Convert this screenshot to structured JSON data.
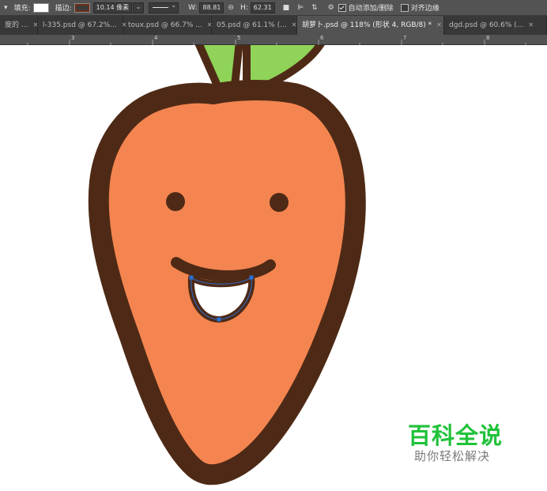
{
  "options_bar": {
    "fill_label": "填充:",
    "fill_color": "#ffffff",
    "stroke_label": "描边:",
    "stroke_color": "#6b2e14",
    "stroke_width": "10.14 像素",
    "w_label": "W:",
    "w_value": "88.81",
    "h_label": "H:",
    "h_value": "62.31",
    "auto_add_delete_label": "自动添加/删除",
    "auto_add_delete_checked": true,
    "align_edges_label": "对齐边缘",
    "align_edges_checked": false
  },
  "tabs": [
    {
      "label": "度的 ...",
      "active": false
    },
    {
      "label": "l-335.psd @ 67.2%...",
      "active": false
    },
    {
      "label": "toux.psd @ 66.7% ...",
      "active": false
    },
    {
      "label": "05.psd @ 61.1% (...",
      "active": false
    },
    {
      "label": "胡萝卜.psd @ 118% (形状 4, RGB/8) *",
      "active": true
    },
    {
      "label": "dgd.psd @ 60.6% (...",
      "active": false
    }
  ],
  "ruler": {
    "numbers": [
      "3",
      "4",
      "5",
      "6",
      "7",
      "8"
    ]
  },
  "illustration": {
    "body_color": "#f48550",
    "outline_color": "#4e2a16",
    "leaf_color": "#8fd358",
    "mouth_inner_color": "#ffffff",
    "path_handle_color": "#2a6fd4"
  },
  "watermark": {
    "title": "百科全说",
    "subtitle": "助你轻松解决"
  }
}
